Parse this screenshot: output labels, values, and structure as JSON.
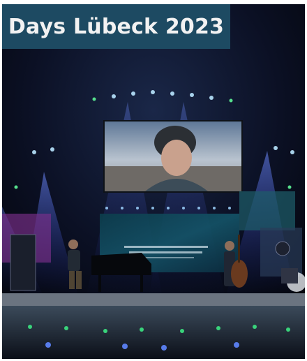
{
  "card": {
    "title": "Days Lübeck 2023",
    "image_alt": "Concert stage with large video screen",
    "title_bg_color": "#1d4a62"
  }
}
